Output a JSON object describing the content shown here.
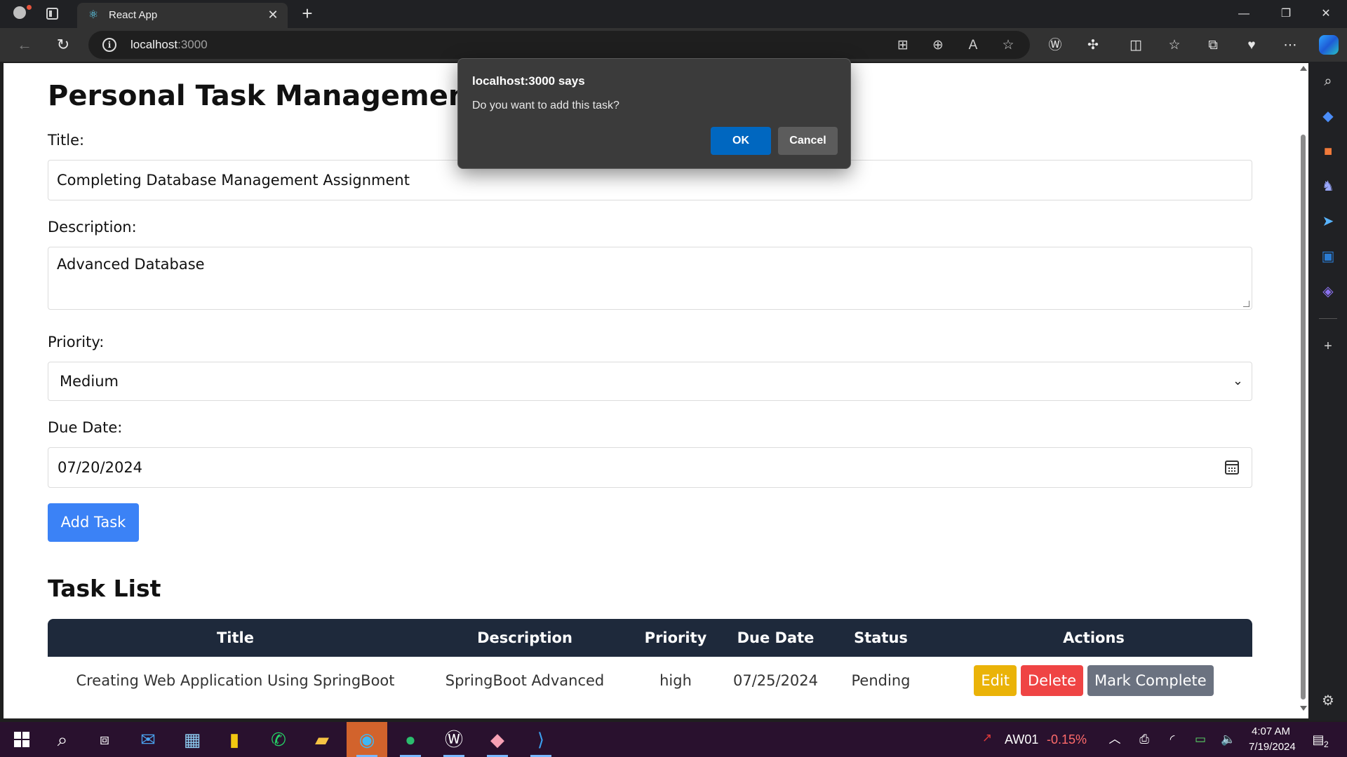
{
  "browser": {
    "tab_title": "React App",
    "tab_close": "✕",
    "new_tab": "+",
    "url_host": "localhost",
    "url_port": ":3000",
    "window_controls": {
      "minimize": "—",
      "restore": "❐",
      "close": "✕"
    }
  },
  "page": {
    "title": "Personal Task Management To",
    "form": {
      "title_label": "Title:",
      "title_value": "Completing Database Management Assignment",
      "description_label": "Description:",
      "description_value": "Advanced Database",
      "priority_label": "Priority:",
      "priority_value": "Medium",
      "due_label": "Due Date:",
      "due_value": "07/20/2024",
      "add_button": "Add Task"
    },
    "task_list": {
      "heading": "Task List",
      "columns": [
        "Title",
        "Description",
        "Priority",
        "Due Date",
        "Status",
        "Actions"
      ],
      "rows": [
        {
          "title": "Creating Web Application Using SpringBoot",
          "description": "SpringBoot Advanced",
          "priority": "high",
          "due_date": "07/25/2024",
          "status": "Pending",
          "actions": {
            "edit": "Edit",
            "delete": "Delete",
            "complete": "Mark Complete"
          }
        }
      ]
    }
  },
  "dialog": {
    "title": "localhost:3000 says",
    "message": "Do you want to add this task?",
    "ok": "OK",
    "cancel": "Cancel"
  },
  "taskbar": {
    "stock_symbol": "AW01",
    "stock_change": "-0.15%",
    "time": "4:07 AM",
    "date": "7/19/2024",
    "notification_count": "2"
  },
  "colors": {
    "accent_blue": "#3b82f6",
    "table_header": "#1e293b",
    "edit": "#eab308",
    "delete": "#ef4444",
    "complete": "#6b7280",
    "dialog_ok": "#0067c0",
    "stock_negative": "#ff6b6b"
  }
}
